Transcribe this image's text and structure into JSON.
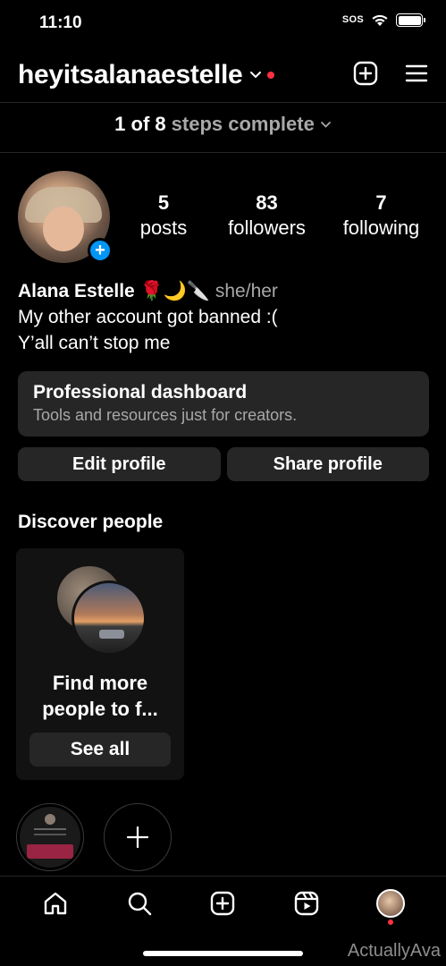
{
  "status_bar": {
    "time": "11:10",
    "sos": "SOS"
  },
  "header": {
    "username": "heyitsalanaestelle"
  },
  "steps": {
    "progress": "1 of 8",
    "label": "steps complete"
  },
  "profile": {
    "stats": [
      {
        "value": "5",
        "label": "posts"
      },
      {
        "value": "83",
        "label": "followers"
      },
      {
        "value": "7",
        "label": "following"
      }
    ],
    "name": "Alana Estelle",
    "emojis": "🌹🌙🔪",
    "pronouns": "she/her",
    "bio_lines": [
      "My other account got banned :(",
      "Y’all can’t stop me"
    ]
  },
  "professional_dashboard": {
    "title": "Professional dashboard",
    "subtitle": "Tools and resources just for creators."
  },
  "buttons": {
    "edit": "Edit profile",
    "share": "Share profile"
  },
  "discover": {
    "title": "Discover people",
    "card_text_line1": "Find more",
    "card_text_line2": "people to f...",
    "see_all": "See all"
  },
  "watermark": "ActuallyAva",
  "icons": {
    "chevron": "chevron-down-icon",
    "new_post": "plus-square-icon",
    "menu": "hamburger-menu-icon",
    "home": "home-icon",
    "search": "search-icon",
    "create": "create-icon",
    "reels": "reels-icon",
    "profile": "profile-avatar"
  },
  "colors": {
    "accent_blue": "#0095f6",
    "notification_red": "#ff3040",
    "surface": "#262626",
    "muted_text": "#a8a8a8"
  }
}
